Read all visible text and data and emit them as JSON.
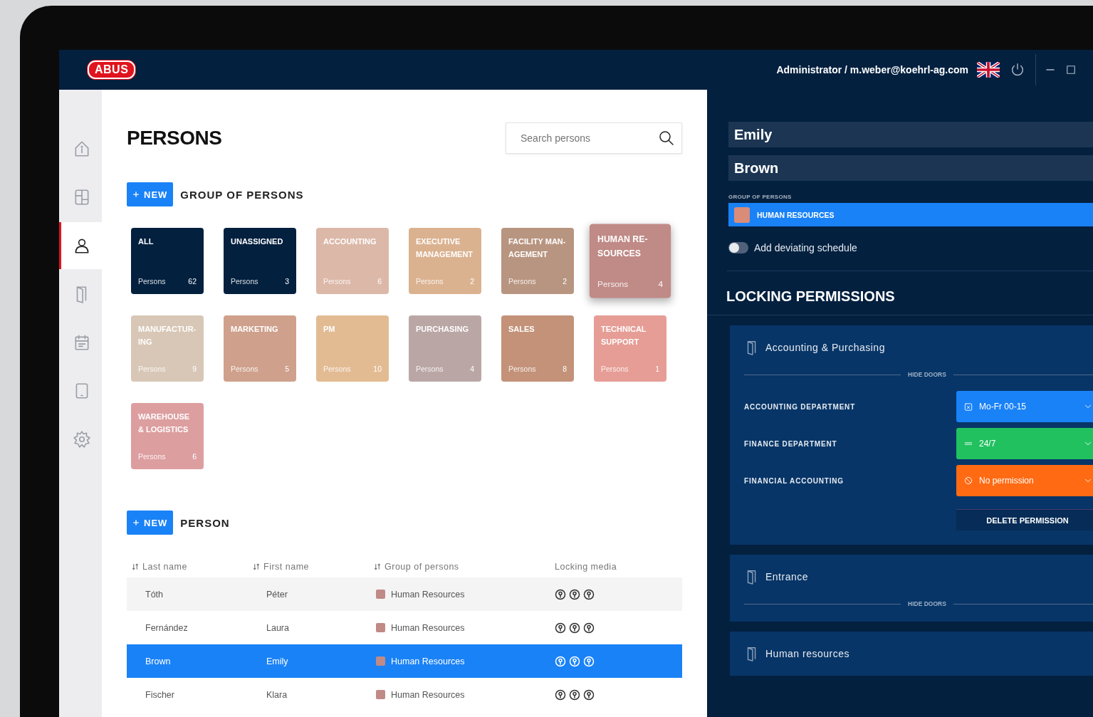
{
  "header": {
    "logo": "ABUS",
    "user": "Administrator / m.weber@koehrl-ag.com"
  },
  "sidebar": {
    "items": [
      {
        "selected": false
      },
      {
        "selected": false
      },
      {
        "selected": true
      },
      {
        "selected": false
      },
      {
        "selected": false
      },
      {
        "selected": false
      },
      {
        "selected": false
      }
    ]
  },
  "page": {
    "title": "PERSONS",
    "search": {
      "placeholder": "Search persons"
    }
  },
  "groups_section": {
    "new_button": "NEW",
    "title": "GROUP OF PERSONS"
  },
  "groups": [
    {
      "name": "ALL",
      "label": "Persons",
      "count": "62",
      "color": "#03203f",
      "selected": false
    },
    {
      "name": "UNASSIGNED",
      "label": "Persons",
      "count": "3",
      "color": "#03203f",
      "selected": false
    },
    {
      "name": "ACCOUNTING",
      "label": "Persons",
      "count": "6",
      "color": "#dcb8a8",
      "selected": false
    },
    {
      "name": "EXECUTIVE MANAGEMENT",
      "label": "Persons",
      "count": "2",
      "color": "#dbb290",
      "selected": false
    },
    {
      "name": "FACILITY MAN-AGEMENT",
      "label": "Persons",
      "count": "2",
      "color": "#b89580",
      "selected": false
    },
    {
      "name": "HUMAN RE-SOURCES",
      "label": "Persons",
      "count": "4",
      "color": "#c08a86",
      "selected": true
    },
    {
      "name": "MANUFACTUR-ING",
      "label": "Persons",
      "count": "9",
      "color": "#d8c7b6",
      "selected": false
    },
    {
      "name": "MARKETING",
      "label": "Persons",
      "count": "5",
      "color": "#cfa08c",
      "selected": false
    },
    {
      "name": "PM",
      "label": "Persons",
      "count": "10",
      "color": "#e3bb93",
      "selected": false
    },
    {
      "name": "PURCHASING",
      "label": "Persons",
      "count": "4",
      "color": "#bba6a6",
      "selected": false
    },
    {
      "name": "SALES",
      "label": "Persons",
      "count": "8",
      "color": "#c39279",
      "selected": false
    },
    {
      "name": "TECHNICAL SUPPORT",
      "label": "Persons",
      "count": "1",
      "color": "#e69d95",
      "selected": false
    },
    {
      "name": "WAREHOUSE & LOGISTICS",
      "label": "Persons",
      "count": "6",
      "color": "#dd9ea0",
      "selected": false
    }
  ],
  "persons_section": {
    "new_button": "NEW",
    "title": "PERSON"
  },
  "table": {
    "columns": [
      {
        "label": "Last name",
        "sortable": true
      },
      {
        "label": "First name",
        "sortable": true
      },
      {
        "label": "Group of persons",
        "sortable": true
      },
      {
        "label": "Locking media",
        "sortable": false
      }
    ],
    "rows": [
      {
        "last_name": "Tóth",
        "first_name": "Péter",
        "group": "Human Resources",
        "color": "#c08a86",
        "selected": false
      },
      {
        "last_name": "Fernández",
        "first_name": "Laura",
        "group": "Human Resources",
        "color": "#c08a86",
        "selected": false
      },
      {
        "last_name": "Brown",
        "first_name": "Emily",
        "group": "Human Resources",
        "color": "#c08a86",
        "selected": true
      },
      {
        "last_name": "Fischer",
        "first_name": "Klara",
        "group": "Human Resources",
        "color": "#c08a86",
        "selected": false
      }
    ]
  },
  "detail": {
    "first_name": "Emily",
    "last_name": "Brown",
    "group_label": "GROUP OF PERSONS",
    "group": {
      "value": "HUMAN RESOURCES",
      "color": "#d98c78"
    },
    "deviating_schedule": {
      "label": "Add deviating schedule",
      "on": false
    },
    "permissions_title": "LOCKING PERMISSIONS",
    "sections": [
      {
        "title": "Accounting & Purchasing",
        "expanded": true,
        "hide_doors": "HIDE DOORS",
        "doors": [
          {
            "name": "ACCOUNTING DEPARTMENT",
            "kind": "schedule",
            "permission": "Mo-Fr 00-15"
          },
          {
            "name": "FINANCE DEPARTMENT",
            "kind": "always",
            "permission": "24/7"
          },
          {
            "name": "FINANCIAL ACCOUNTING",
            "kind": "none",
            "permission": "No permission"
          }
        ],
        "delete_button": "DELETE PERMISSION"
      },
      {
        "title": "Entrance",
        "expanded": false,
        "hide_doors": "HIDE DOORS"
      },
      {
        "title": "Human resources",
        "expanded": false
      }
    ]
  }
}
